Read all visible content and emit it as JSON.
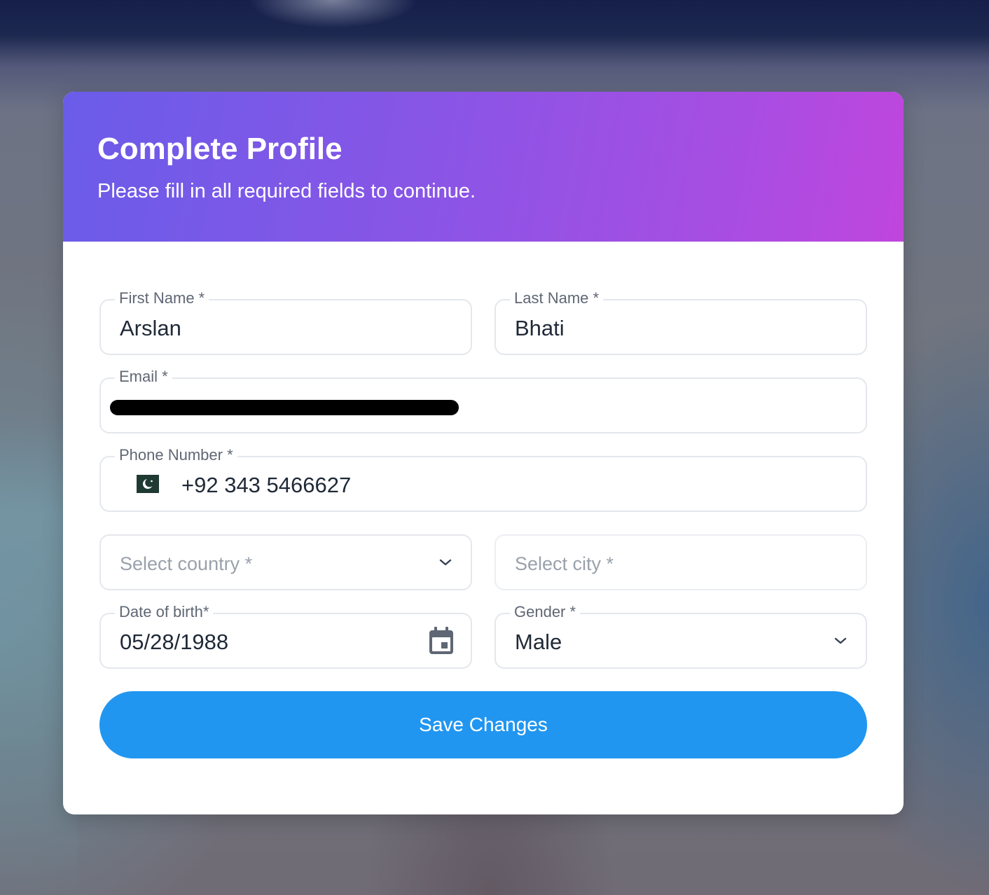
{
  "header": {
    "title": "Complete Profile",
    "subtitle": "Please fill in all required fields to continue."
  },
  "form": {
    "first_name": {
      "label": "First Name *",
      "value": "Arslan"
    },
    "last_name": {
      "label": "Last Name *",
      "value": "Bhati"
    },
    "email": {
      "label": "Email *",
      "value": "",
      "redacted": true
    },
    "phone": {
      "label": "Phone Number *",
      "value": "+92 343 5466627",
      "flag_icon": "pakistan-flag-icon"
    },
    "country": {
      "placeholder": "Select country *",
      "icon": "chevron-down-icon"
    },
    "city": {
      "placeholder": "Select city *"
    },
    "date_of_birth": {
      "label": "Date of birth*",
      "value": "05/28/1988",
      "icon": "calendar-icon"
    },
    "gender": {
      "label": "Gender *",
      "value": "Male",
      "icon": "chevron-down-icon"
    },
    "save_label": "Save Changes"
  },
  "colors": {
    "header_gradient_start": "#6a5ce9",
    "header_gradient_end": "#c046dd",
    "primary_button": "#2196f0",
    "flag_green": "#1f3a32"
  }
}
